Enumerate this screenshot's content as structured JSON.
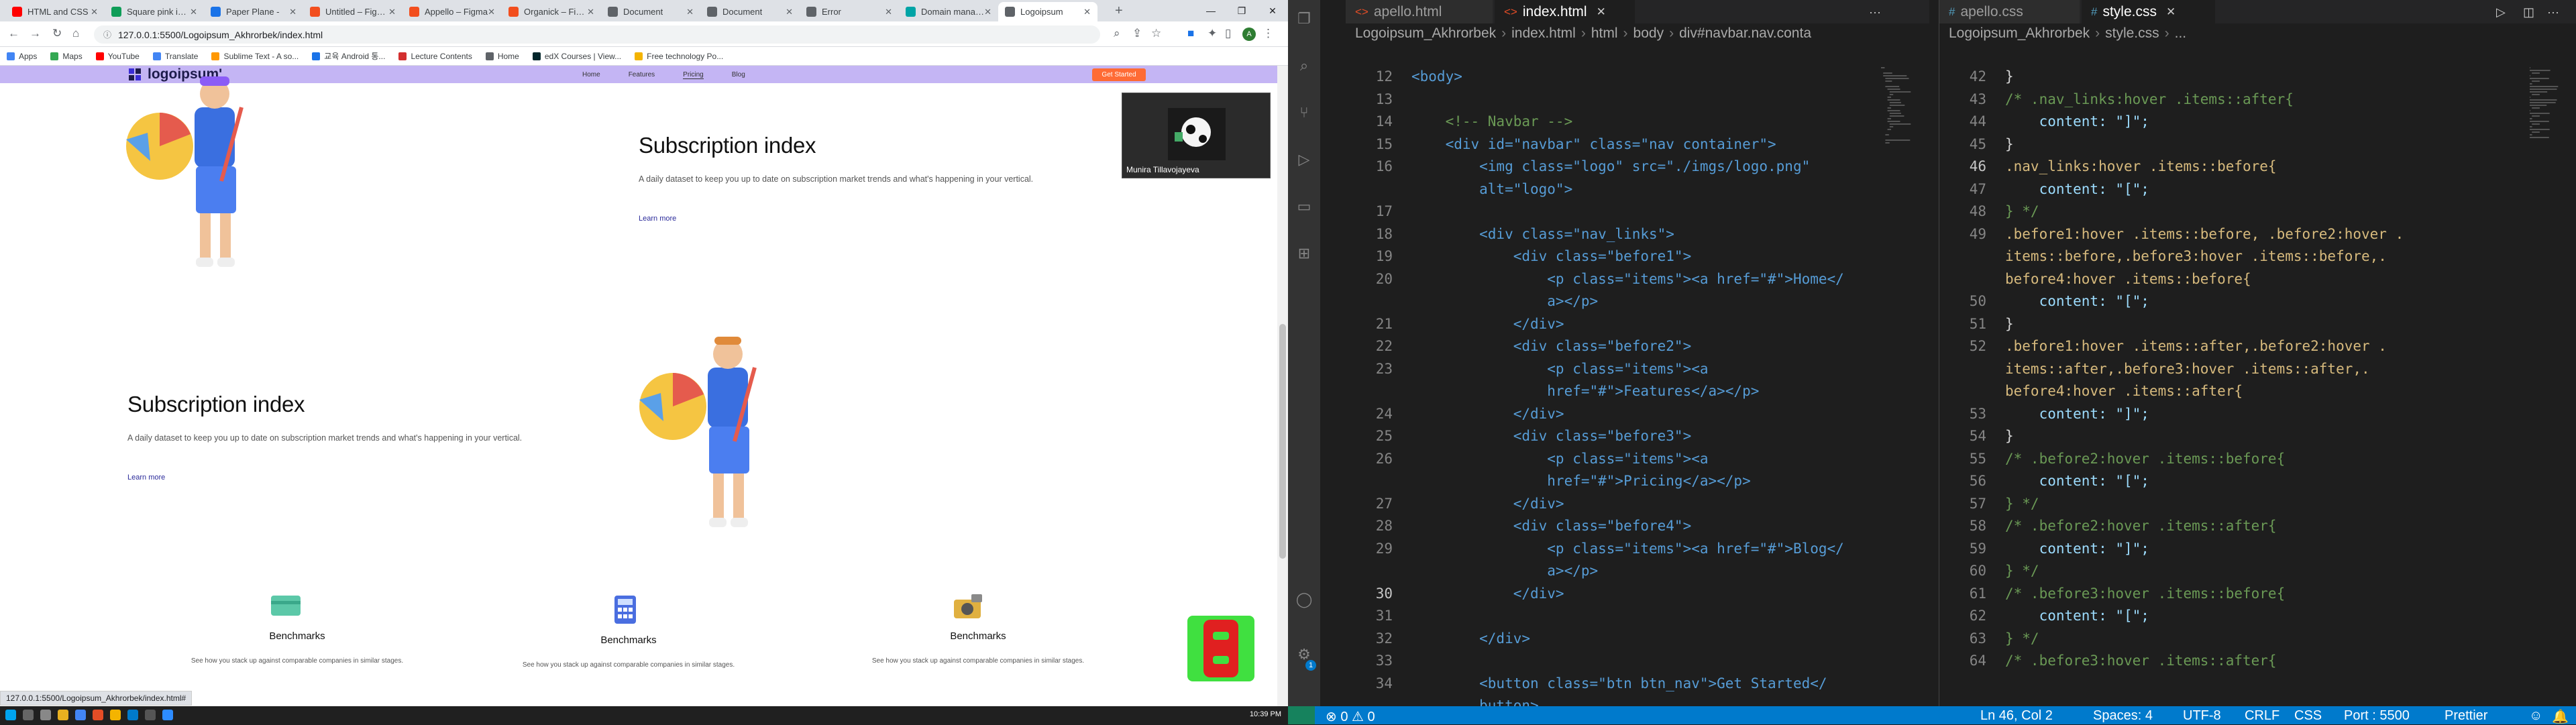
{
  "browser": {
    "tabs": [
      {
        "label": "HTML and CSS",
        "color": "#ff0000"
      },
      {
        "label": "Square pink icon",
        "color": "#0f9d58"
      },
      {
        "label": "Paper Plane -",
        "color": "#1a73e8"
      },
      {
        "label": "Untitled – Figma",
        "color": "#f24e1e"
      },
      {
        "label": "Appello – Figma",
        "color": "#f24e1e"
      },
      {
        "label": "Organick – Figma",
        "color": "#f24e1e"
      },
      {
        "label": "Document",
        "color": "#5f6368"
      },
      {
        "label": "Document",
        "color": "#5f6368"
      },
      {
        "label": "Error",
        "color": "#5f6368"
      },
      {
        "label": "Domain manage",
        "color": "#00a4a6"
      },
      {
        "label": "Logoipsum",
        "color": "#5f6368"
      }
    ],
    "url": "127.0.0.1:5500/Logoipsum_Akhrorbek/index.html",
    "bookmarks": [
      {
        "label": "Apps",
        "color": "#4285f4"
      },
      {
        "label": "Maps",
        "color": "#34a853"
      },
      {
        "label": "YouTube",
        "color": "#ff0000"
      },
      {
        "label": "Translate",
        "color": "#4285f4"
      },
      {
        "label": "Sublime Text - A so...",
        "color": "#ff9800"
      },
      {
        "label": "교육 Android 통...",
        "color": "#1a73e8"
      },
      {
        "label": "Lecture Contents",
        "color": "#d32f2f"
      },
      {
        "label": "Home",
        "color": "#5f6368"
      },
      {
        "label": "edX Courses | View...",
        "color": "#02262b"
      },
      {
        "label": "Free technology Po...",
        "color": "#f4b400"
      }
    ],
    "status_url": "127.0.0.1:5500/Logoipsum_Akhrorbek/index.html#"
  },
  "site": {
    "logo": "logoipsum'",
    "nav": [
      "Home",
      "Features",
      "Pricing",
      "Blog"
    ],
    "cta": "Get Started",
    "section1": {
      "title": "Subscription index",
      "desc": "A daily dataset to keep you up to date on subscription market trends and what's happening in your vertical.",
      "link": "Learn more"
    },
    "section2": {
      "title": "Subscription index",
      "desc": "A daily dataset to keep you up to date on subscription market trends and what's happening in your vertical.",
      "link": "Learn more"
    },
    "benchmarks": [
      {
        "title": "Benchmarks",
        "desc": "See how you stack up against comparable companies in similar stages.",
        "icon": "card-icon",
        "color": "#5cc8a8"
      },
      {
        "title": "Benchmarks",
        "desc": "See how you stack up against comparable companies in similar stages.",
        "icon": "calculator-icon",
        "color": "#4a6ee0"
      },
      {
        "title": "Benchmarks",
        "desc": "See how you stack up against comparable companies in similar stages.",
        "icon": "camera-icon",
        "color": "#e0b040"
      }
    ],
    "video_name": "Munira Tillavojayeva"
  },
  "vscode": {
    "left_tabs": [
      "apello.html",
      "index.html"
    ],
    "left_crumbs": [
      "Logoipsum_Akhrorbek",
      "index.html",
      "html",
      "body",
      "div#navbar.nav.conta"
    ],
    "right_tabs": [
      "apello.css",
      "style.css"
    ],
    "right_crumbs": [
      "Logoipsum_Akhrorbek",
      "style.css",
      "..."
    ],
    "html_lines": [
      {
        "n": "12",
        "t": "<body>"
      },
      {
        "n": "13",
        "t": ""
      },
      {
        "n": "14",
        "t": "    <!-- Navbar -->"
      },
      {
        "n": "15",
        "t": "    <div id=\"navbar\" class=\"nav container\">"
      },
      {
        "n": "16",
        "t": "        <img class=\"logo\" src=\"./imgs/logo.png\""
      },
      {
        "n": "",
        "t": "        alt=\"logo\">"
      },
      {
        "n": "17",
        "t": ""
      },
      {
        "n": "18",
        "t": "        <div class=\"nav_links\">"
      },
      {
        "n": "19",
        "t": "            <div class=\"before1\">"
      },
      {
        "n": "20",
        "t": "                <p class=\"items\"><a href=\"#\">Home</"
      },
      {
        "n": "",
        "t": "                a></p>"
      },
      {
        "n": "21",
        "t": "            </div>"
      },
      {
        "n": "22",
        "t": "            <div class=\"before2\">"
      },
      {
        "n": "23",
        "t": "                <p class=\"items\"><a"
      },
      {
        "n": "",
        "t": "                href=\"#\">Features</a></p>"
      },
      {
        "n": "24",
        "t": "            </div>"
      },
      {
        "n": "25",
        "t": "            <div class=\"before3\">"
      },
      {
        "n": "26",
        "t": "                <p class=\"items\"><a"
      },
      {
        "n": "",
        "t": "                href=\"#\">Pricing</a></p>"
      },
      {
        "n": "27",
        "t": "            </div>"
      },
      {
        "n": "28",
        "t": "            <div class=\"before4\">"
      },
      {
        "n": "29",
        "t": "                <p class=\"items\"><a href=\"#\">Blog</"
      },
      {
        "n": "",
        "t": "                a></p>"
      },
      {
        "n": "30",
        "t": "            </div>"
      },
      {
        "n": "31",
        "t": ""
      },
      {
        "n": "32",
        "t": "        </div>"
      },
      {
        "n": "33",
        "t": ""
      },
      {
        "n": "34",
        "t": "        <button class=\"btn btn_nav\">Get Started</"
      },
      {
        "n": "",
        "t": "        button>"
      }
    ],
    "css_lines": [
      {
        "n": "42",
        "t": "}"
      },
      {
        "n": "43",
        "t": "/* .nav_links:hover .items::after{"
      },
      {
        "n": "44",
        "t": "    content: \"]\";"
      },
      {
        "n": "45",
        "t": "}"
      },
      {
        "n": "46",
        "t": ".nav_links:hover .items::before{"
      },
      {
        "n": "47",
        "t": "    content: \"[\";"
      },
      {
        "n": "48",
        "t": "} */"
      },
      {
        "n": "49",
        "t": ".before1:hover .items::before, .before2:hover ."
      },
      {
        "n": "",
        "t": "items::before,.before3:hover .items::before,."
      },
      {
        "n": "",
        "t": "before4:hover .items::before{"
      },
      {
        "n": "50",
        "t": "    content: \"[\";"
      },
      {
        "n": "51",
        "t": "}"
      },
      {
        "n": "52",
        "t": ".before1:hover .items::after,.before2:hover ."
      },
      {
        "n": "",
        "t": "items::after,.before3:hover .items::after,."
      },
      {
        "n": "",
        "t": "before4:hover .items::after{"
      },
      {
        "n": "53",
        "t": "    content: \"]\";"
      },
      {
        "n": "54",
        "t": "}"
      },
      {
        "n": "55",
        "t": "/* .before2:hover .items::before{"
      },
      {
        "n": "56",
        "t": "    content: \"[\";"
      },
      {
        "n": "57",
        "t": "} */"
      },
      {
        "n": "58",
        "t": "/* .before2:hover .items::after{"
      },
      {
        "n": "59",
        "t": "    content: \"]\";"
      },
      {
        "n": "60",
        "t": "} */"
      },
      {
        "n": "61",
        "t": "/* .before3:hover .items::before{"
      },
      {
        "n": "62",
        "t": "    content: \"[\";"
      },
      {
        "n": "63",
        "t": "} */"
      },
      {
        "n": "64",
        "t": "/* .before3:hover .items::after{"
      }
    ],
    "status": {
      "errors": "0",
      "warnings": "0",
      "position": "Ln 46, Col 2",
      "spaces": "Spaces: 4",
      "encoding": "UTF-8",
      "eol": "CRLF",
      "language": "CSS",
      "port": "Port : 5500",
      "formatter": "Prettier"
    },
    "badge": "1"
  },
  "taskbar": {
    "time": "10:39 PM"
  }
}
